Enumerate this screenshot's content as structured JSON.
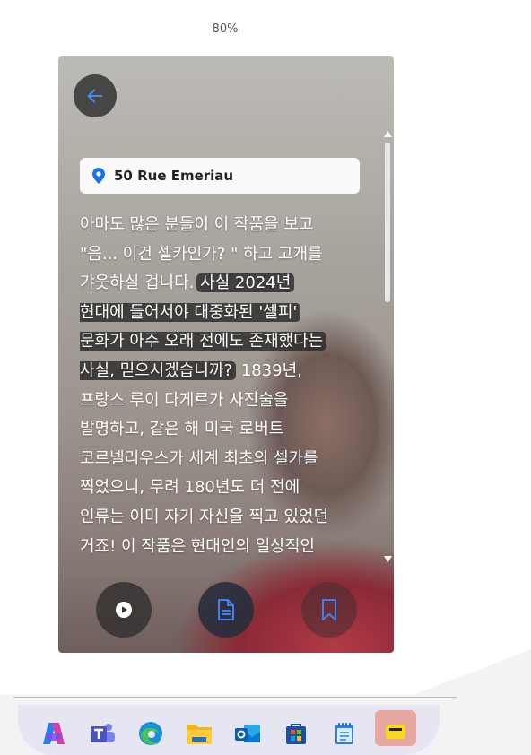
{
  "zoom_level": "80%",
  "location": {
    "address": "50 Rue Emeriau",
    "pin_icon": "location-pin-icon",
    "pin_color": "#1a73e8"
  },
  "story": {
    "lines": [
      {
        "before": "아마도 많은 분들이 이 작품을 보고",
        "highlight": "",
        "after": ""
      },
      {
        "before": "\"음... 이건 셀카인가? \" 하고 고개를",
        "highlight": "",
        "after": ""
      },
      {
        "before": "갸웃하실 겁니다. ",
        "highlight": "사실 2024년",
        "after": ""
      },
      {
        "before": "",
        "highlight": "현대에 들어서야 대중화된 '셀피'",
        "after": ""
      },
      {
        "before": "",
        "highlight": "문화가 아주 오래 전에도 존재했다는",
        "after": ""
      },
      {
        "before": "",
        "highlight": "사실, 믿으시겠습니까?",
        "after": " 1839년,"
      },
      {
        "before": "프랑스 루이 다게르가 사진술을",
        "highlight": "",
        "after": ""
      },
      {
        "before": "발명하고, 같은 해 미국 로버트",
        "highlight": "",
        "after": ""
      },
      {
        "before": "코르넬리우스가 세계 최초의 셀카를",
        "highlight": "",
        "after": ""
      },
      {
        "before": "찍었으니, 무려 180년도 더 전에",
        "highlight": "",
        "after": ""
      },
      {
        "before": "인류는 이미 자기 자신을 찍고 있었던",
        "highlight": "",
        "after": ""
      },
      {
        "before": "거죠! 이 작품은 현대인의 일상적인",
        "highlight": "",
        "after": ""
      }
    ]
  },
  "controls": {
    "back": "back-arrow-icon",
    "play": "play-icon",
    "document": "document-icon",
    "bookmark": "bookmark-icon",
    "accent_color": "#3b82f6"
  },
  "taskbar": {
    "icons": [
      "copilot-icon",
      "teams-icon",
      "edge-icon",
      "file-explorer-icon",
      "outlook-icon",
      "microsoft-store-icon",
      "notepad-icon",
      "sticky-app-icon"
    ]
  }
}
